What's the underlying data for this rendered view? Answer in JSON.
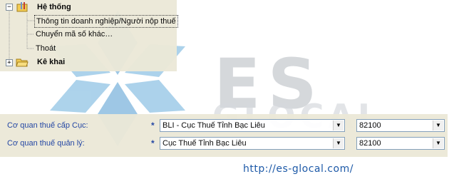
{
  "watermark": {
    "logo_text": "ES",
    "logo_subtext": "GLOCAL",
    "url": "http://es-glocal.com/",
    "colors": {
      "logo_blue": "#4f9bd0",
      "logo_gray": "#c7cbd0",
      "url_blue": "#1e5aa8"
    }
  },
  "tree": {
    "root": {
      "label": "Hệ thống",
      "expanded": true,
      "icon": "tools-folder-icon"
    },
    "children": [
      {
        "label": "Thông tin doanh nghiệp/Người nộp thuế",
        "selected": true
      },
      {
        "label": "Chuyển mã số khác…"
      },
      {
        "label": "Thoát"
      }
    ],
    "second": {
      "label": "Kê khai",
      "expanded": false,
      "icon": "open-folder-icon"
    }
  },
  "form": {
    "rows": [
      {
        "label": "Cơ quan thuế cấp Cục:",
        "required_mark": "*",
        "select_value": "BLI - Cục Thuế Tỉnh Bạc Liêu",
        "code_value": "82100"
      },
      {
        "label": "Cơ quan thuế quản lý:",
        "required_mark": "*",
        "select_value": "Cục Thuế Tỉnh Bạc Liêu",
        "code_value": "82100"
      }
    ],
    "colors": {
      "label": "#1b3fa0",
      "panel_bg": "#ece9d8"
    }
  }
}
